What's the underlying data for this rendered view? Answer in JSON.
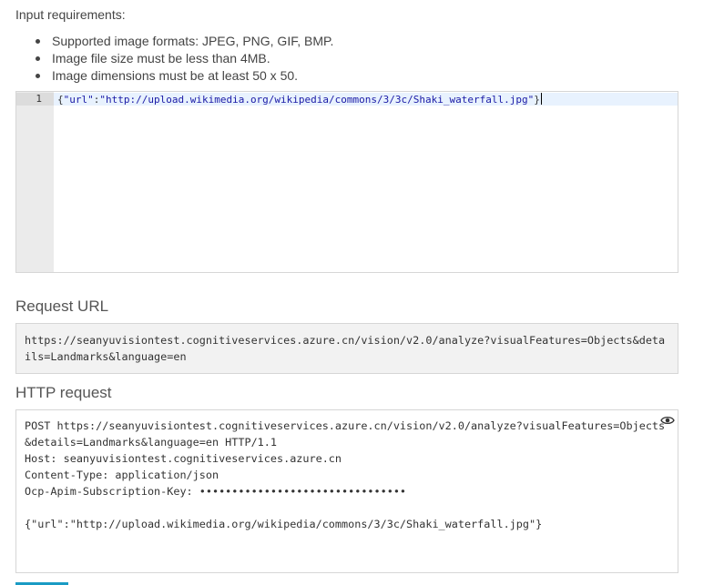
{
  "input_requirements": {
    "label": "Input requirements:",
    "items": [
      "Supported image formats: JPEG, PNG, GIF, BMP.",
      "Image file size must be less than 4MB.",
      "Image dimensions must be at least 50 x 50."
    ]
  },
  "editor": {
    "line_number": "1",
    "tokens": {
      "open": "{",
      "key": "\"url\"",
      "colon": ":",
      "value": "\"http://upload.wikimedia.org/wikipedia/commons/3/3c/Shaki_waterfall.jpg\"",
      "close": "}"
    }
  },
  "request_url": {
    "heading": "Request URL",
    "value": "https://seanyuvisiontest.cognitiveservices.azure.cn/vision/v2.0/analyze?visualFeatures=Objects&details=Landmarks&language=en"
  },
  "http_request": {
    "heading": "HTTP request",
    "first_line": "POST https://seanyuvisiontest.cognitiveservices.azure.cn/vision/v2.0/analyze?visualFeatures=Objects&details=Landmarks&language=en HTTP/1.1",
    "host": "Host: seanyuvisiontest.cognitiveservices.azure.cn",
    "content_type": "Content-Type: application/json",
    "subscription_key": "Ocp-Apim-Subscription-Key: ••••••••••••••••••••••••••••••••",
    "body": "{\"url\":\"http://upload.wikimedia.org/wikipedia/commons/3/3c/Shaki_waterfall.jpg\"}",
    "reveal_icon": "eye-icon"
  },
  "colors": {
    "accent": "#1a9bc4",
    "code_string": "#1a1aa6",
    "active_line": "#e8f2fe"
  }
}
